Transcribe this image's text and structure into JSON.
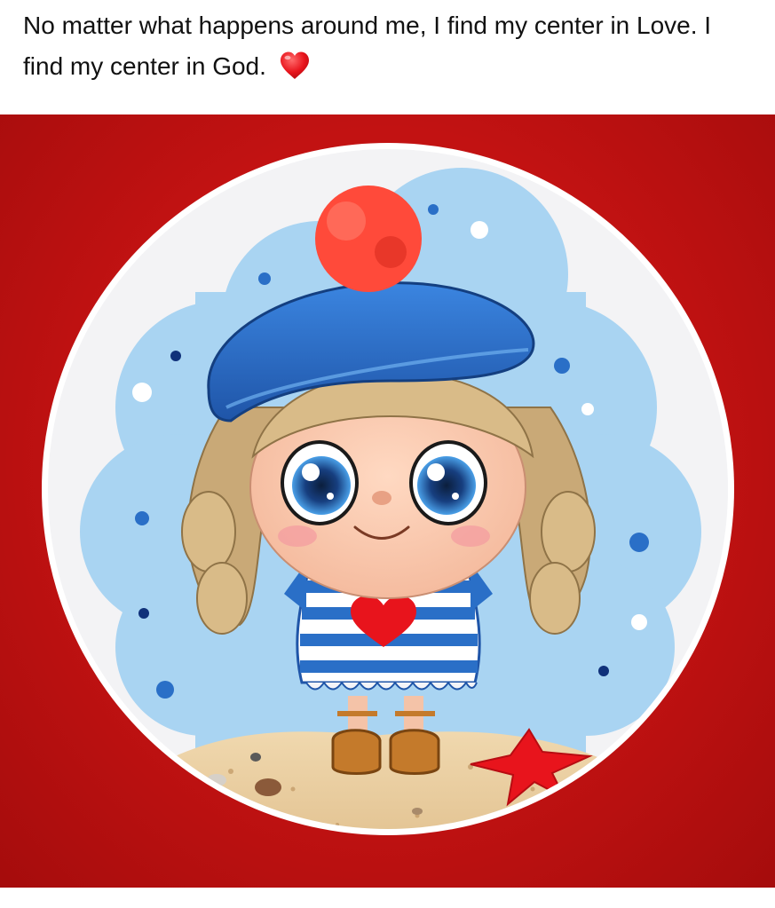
{
  "post": {
    "caption": "No matter what happens around me, I find my center in Love. I find my center in God.",
    "emoji": "red-heart-icon"
  },
  "image": {
    "subject": "cartoon-girl-illustration",
    "background_color": "#c81414",
    "frame_color": "#ffffff",
    "accent_colors": {
      "hat": "#2a6fc7",
      "pompom": "#ff4a3a",
      "heart": "#e8141c",
      "starfish": "#e8141c",
      "sky": "#a9d4f2",
      "sand": "#e9cfa2"
    }
  }
}
